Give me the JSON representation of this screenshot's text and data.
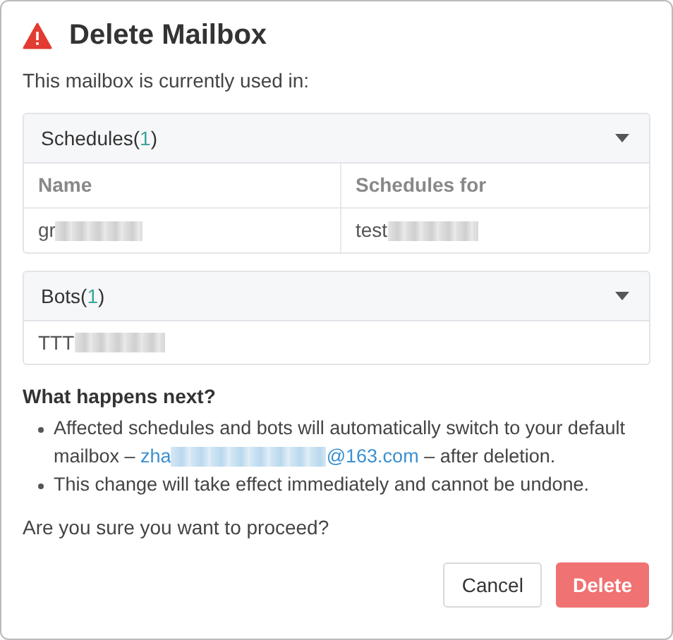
{
  "dialog": {
    "title": "Delete Mailbox",
    "intro": "This mailbox is currently used in:"
  },
  "sections": [
    {
      "kind": "table",
      "label": "Schedules(",
      "count": "1",
      "suffix": ")",
      "expanded": true,
      "columns": [
        "Name",
        "Schedules for"
      ],
      "rows": [
        {
          "cells": [
            "gr",
            "test"
          ]
        }
      ]
    },
    {
      "kind": "list",
      "label": "Bots(",
      "count": "1",
      "suffix": ")",
      "expanded": true,
      "items": [
        "TTT"
      ]
    }
  ],
  "next": {
    "heading": "What happens next?",
    "bullets": [
      {
        "before": "Affected schedules and bots will automatically switch to your default mailbox –",
        "email_start": "zha",
        "email_end": "@163.com",
        "after": "– after deletion."
      },
      {
        "before": "This change will take effect immediately and cannot be undone."
      }
    ]
  },
  "question": "Are you sure you want to proceed?",
  "buttons": [
    {
      "kind": "secondary",
      "label": "Cancel"
    },
    {
      "kind": "danger",
      "label": "Delete"
    }
  ]
}
